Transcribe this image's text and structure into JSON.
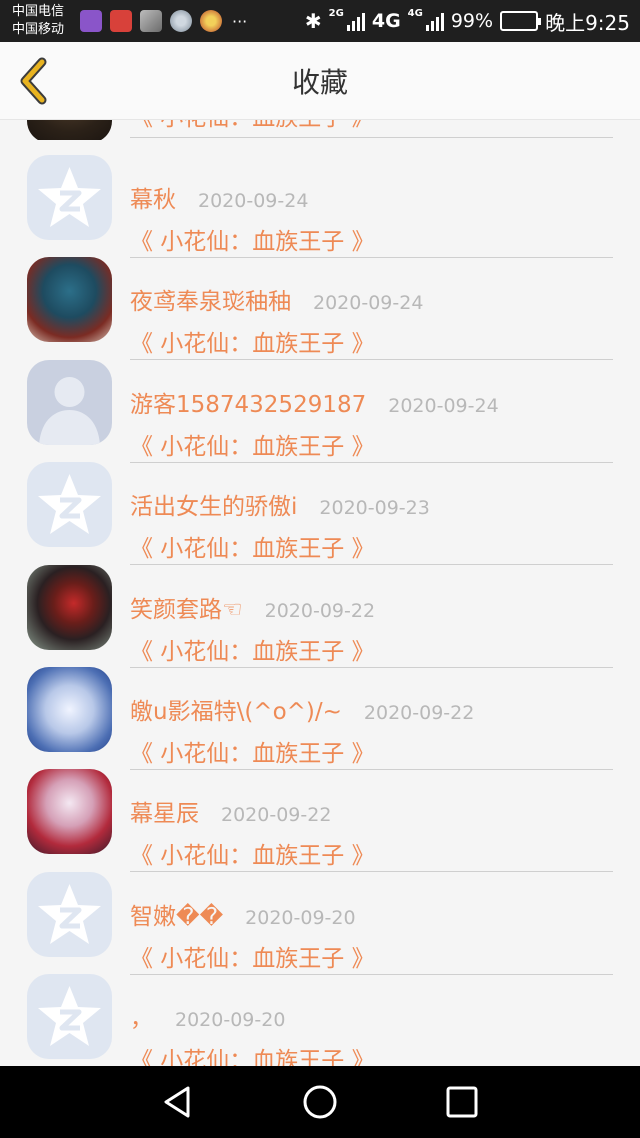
{
  "status_bar": {
    "carrier_1": "中国电信",
    "carrier_2": "中国移动",
    "more": "···",
    "network_small": "2G",
    "network": "4G",
    "network_small_2": "4G",
    "battery": "99%",
    "battery_level": 0.99,
    "time": "晚上9:25"
  },
  "header": {
    "title": "收藏",
    "back_icon": "chevron-left-icon"
  },
  "list": {
    "partial_book": "《 小花仙：血族王子 》",
    "items": [
      {
        "name": "幕秋",
        "date": "2020-09-24",
        "book": "《 小花仙：血族王子 》",
        "avatar": "qzone-default"
      },
      {
        "name": "夜鸢奉泉珳秞秞",
        "date": "2020-09-24",
        "book": "《 小花仙：血族王子 》",
        "avatar": "photo"
      },
      {
        "name": "游客1587432529187",
        "date": "2020-09-24",
        "book": "《 小花仙：血族王子 》",
        "avatar": "default-person"
      },
      {
        "name": "活出女生的骄傲i",
        "date": "2020-09-23",
        "book": "《 小花仙：血族王子 》",
        "avatar": "qzone-default"
      },
      {
        "name": "笑颜套路☜",
        "date": "2020-09-22",
        "book": "《 小花仙：血族王子 》",
        "avatar": "photo"
      },
      {
        "name": "皦u影福特\\(^o^)/~",
        "date": "2020-09-22",
        "book": "《 小花仙：血族王子 》",
        "avatar": "photo"
      },
      {
        "name": "幕星辰",
        "date": "2020-09-22",
        "book": "《 小花仙：血族王子 》",
        "avatar": "photo"
      },
      {
        "name": "智嫩��",
        "date": "2020-09-20",
        "book": "《 小花仙：血族王子 》",
        "avatar": "qzone-default"
      },
      {
        "name": "，",
        "date": "2020-09-20",
        "book": "《 小花仙：血族王子 》",
        "avatar": "qzone-default"
      }
    ]
  },
  "colors": {
    "accent": "#ee8a55",
    "date": "#b8b8b8",
    "back_icon": "#e8b320",
    "header_bg": "#fafafa",
    "list_bg": "#f5f5f5"
  },
  "nav_bar": {
    "back_icon": "triangle-back-icon",
    "home_icon": "circle-home-icon",
    "recent_icon": "square-recent-icon"
  }
}
